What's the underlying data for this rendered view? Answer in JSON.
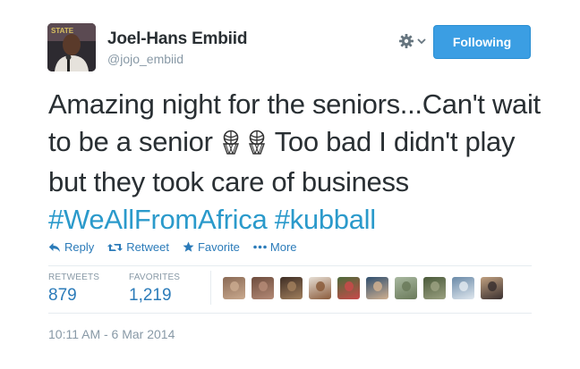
{
  "user": {
    "name": "Joel-Hans Embiid",
    "handle": "@jojo_embiid"
  },
  "follow_button": {
    "label": "Following"
  },
  "tweet": {
    "text_part1": "Amazing night for the seniors...Can't wait to be a senior ",
    "emoji": [
      "basketball-hoop-icon",
      "basketball-hoop-icon"
    ],
    "text_part2": " Too bad I didn't play but they took care of business ",
    "hashtags": [
      "#WeAllFromAfrica",
      "#kubball"
    ]
  },
  "actions": [
    {
      "label": "Reply",
      "icon": "reply-icon"
    },
    {
      "label": "Retweet",
      "icon": "retweet-icon"
    },
    {
      "label": "Favorite",
      "icon": "star-icon"
    },
    {
      "label": "More",
      "icon": "more-dots-icon"
    }
  ],
  "stats": {
    "retweets_label": "RETWEETS",
    "retweets_value": "879",
    "favorites_label": "FAVORITES",
    "favorites_value": "1,219"
  },
  "favoriters": [
    {
      "colors": [
        "#8a6a55",
        "#c9a98e"
      ]
    },
    {
      "colors": [
        "#6d4c3d",
        "#b48a76"
      ]
    },
    {
      "colors": [
        "#3f2e25",
        "#a07e5c"
      ]
    },
    {
      "colors": [
        "#e7dfd5",
        "#8a5a3a"
      ]
    },
    {
      "colors": [
        "#4b6b3a",
        "#c84a4a"
      ]
    },
    {
      "colors": [
        "#2f4f6f",
        "#d0b090"
      ]
    },
    {
      "colors": [
        "#a8b8a0",
        "#6a7a5a"
      ]
    },
    {
      "colors": [
        "#4a5a3a",
        "#9aa080"
      ]
    },
    {
      "colors": [
        "#6a8aa8",
        "#dfe7ee"
      ]
    },
    {
      "colors": [
        "#c0a080",
        "#3a3030"
      ]
    }
  ],
  "timestamp": "10:11 AM - 6 Mar 2014",
  "colors": {
    "accent": "#2b7bb9",
    "hashtag": "#2b9acb",
    "button": "#3b9ee3",
    "muted": "#8899a6"
  }
}
